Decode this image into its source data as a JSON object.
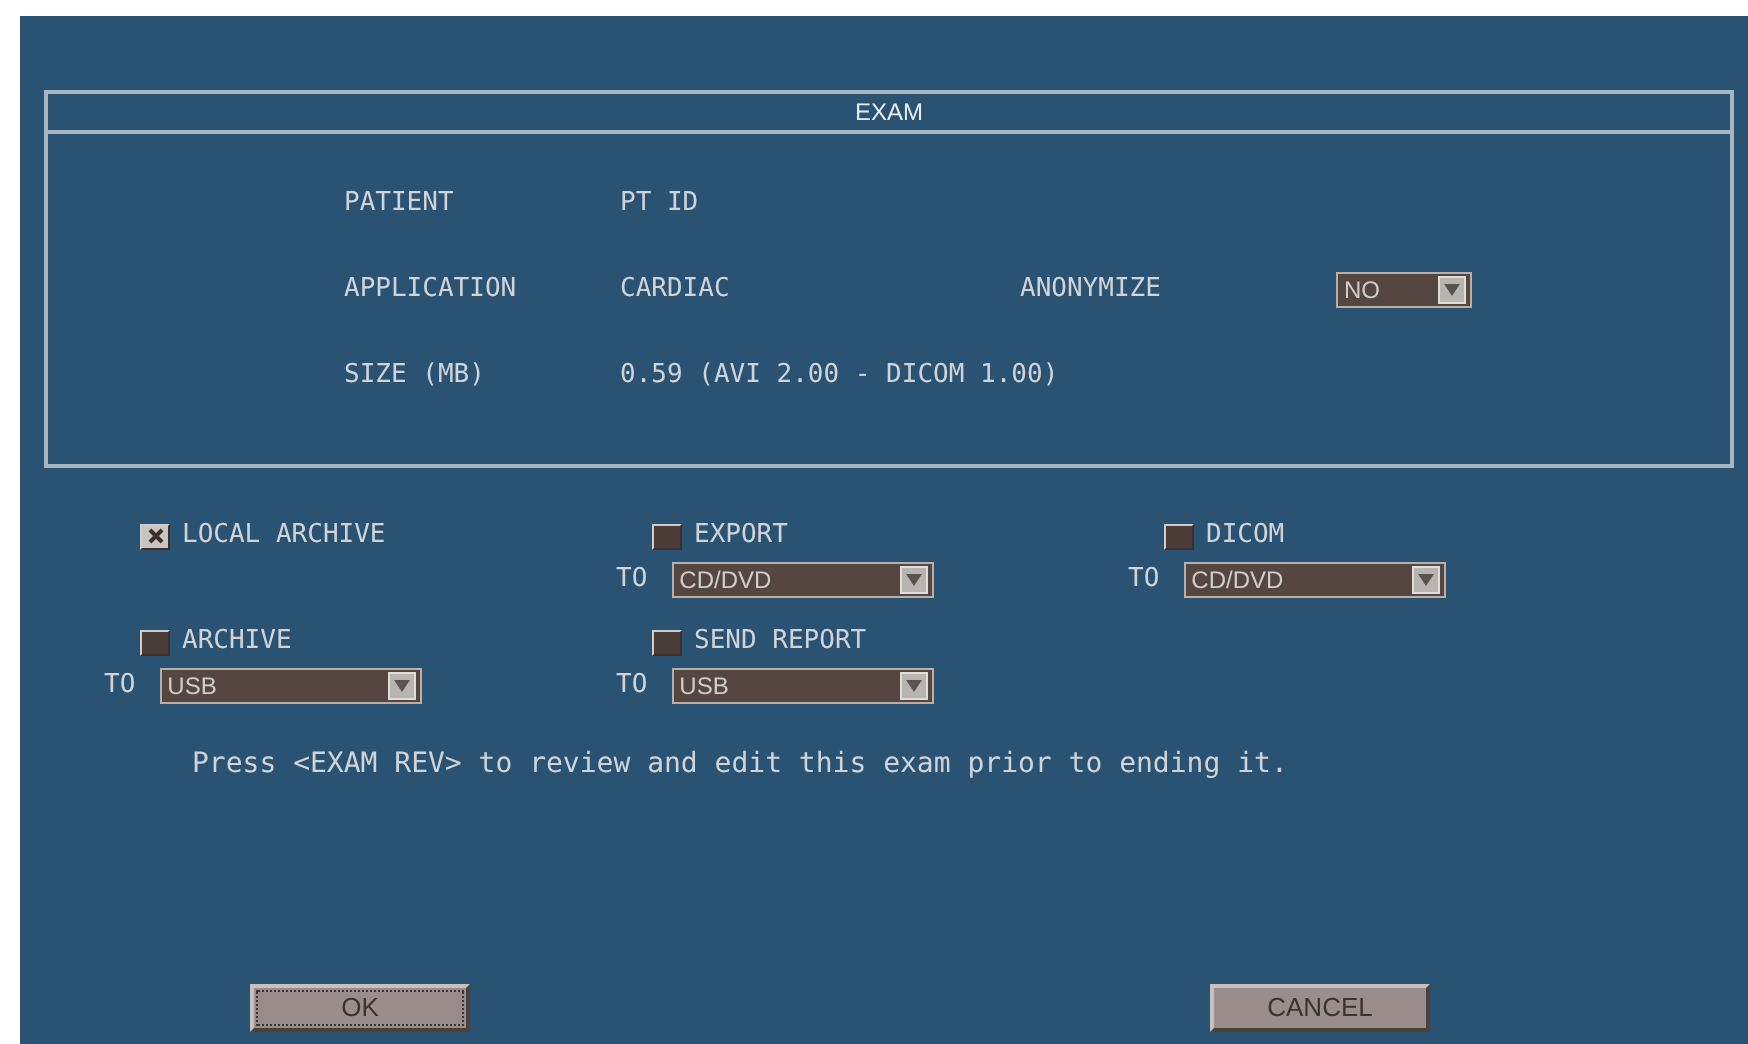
{
  "exam": {
    "title": "EXAM",
    "fields": [
      {
        "label": "PATIENT",
        "value": "PT ID"
      },
      {
        "label": "APPLICATION",
        "value": "CARDIAC"
      },
      {
        "label": "SIZE (MB)",
        "value": "0.59 (AVI 2.00 - DICOM 1.00)"
      }
    ],
    "anonymize": {
      "label": "ANONYMIZE",
      "value": "NO"
    }
  },
  "option_rows": [
    [
      {
        "label": "LOCAL ARCHIVE",
        "checked": true
      },
      {
        "label": "EXPORT",
        "checked": false,
        "to": "TO",
        "destination": "CD/DVD"
      },
      {
        "label": "DICOM",
        "checked": false,
        "to": "TO",
        "destination": "CD/DVD"
      }
    ],
    [
      {
        "label": "ARCHIVE",
        "checked": false,
        "to": "TO",
        "destination": "USB"
      },
      {
        "label": "SEND REPORT",
        "checked": false,
        "to": "TO",
        "destination": "USB"
      }
    ]
  ],
  "message": "Press <EXAM REV> to review and edit this exam prior to ending it.",
  "buttons": [
    {
      "label": "OK",
      "focused": true
    },
    {
      "label": "CANCEL",
      "focused": false
    }
  ]
}
